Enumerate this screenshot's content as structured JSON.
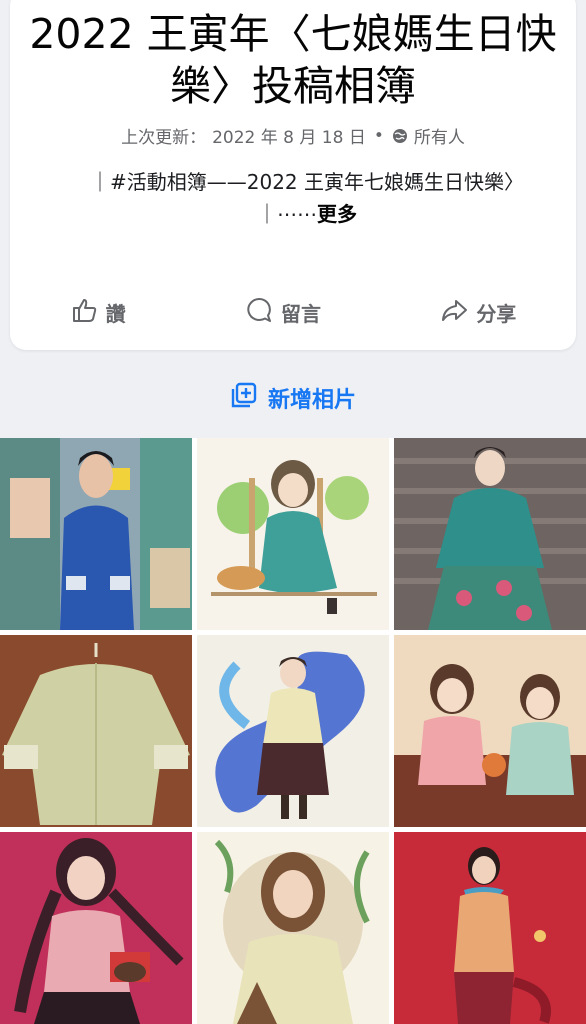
{
  "album": {
    "title": "2022 王寅年〈七娘媽生日快樂〉投稿相簿",
    "updated_label": "上次更新：",
    "updated_date": "2022 年 8 月 18 日",
    "bullet": "•",
    "audience": "所有人",
    "description": "｜#活動相簿——2022 王寅年七娘媽生日快樂〉｜⋯⋯",
    "more_label": "更多"
  },
  "actions": {
    "like": "讚",
    "comment": "留言",
    "share": "分享"
  },
  "add_photo_label": "新增相片",
  "photos": [
    {
      "icon": "photo-woman-blue-shirt",
      "color": "#2f5fb0"
    },
    {
      "icon": "photo-girl-illustration-cat",
      "color": "#5aa39a"
    },
    {
      "icon": "photo-doll-teal-jacket",
      "color": "#2d8b8a"
    },
    {
      "icon": "photo-green-jacket-hanger",
      "color": "#c9c896"
    },
    {
      "icon": "photo-illustration-swirl",
      "color": "#3a5fcf"
    },
    {
      "icon": "photo-two-girls-illustration",
      "color": "#e6c7a6"
    },
    {
      "icon": "photo-braided-girl-illustration",
      "color": "#c0305a"
    },
    {
      "icon": "photo-woman-yellow-sweater",
      "color": "#d7cfb0"
    },
    {
      "icon": "photo-woman-red-background",
      "color": "#c72b3a"
    }
  ],
  "colors": {
    "accent": "#1877f2",
    "muted_text": "#65676b"
  }
}
